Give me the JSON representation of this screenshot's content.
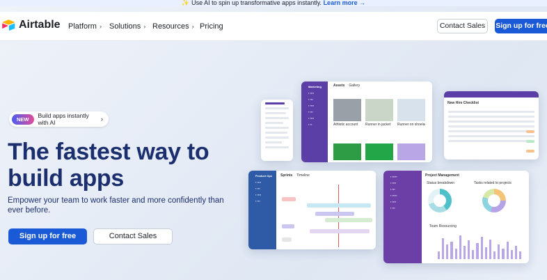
{
  "announcement": {
    "text": "Use AI to spin up transformative apps instantly.",
    "link": "Learn more →"
  },
  "nav": {
    "brand": "Airtable",
    "items": [
      {
        "label": "Platform",
        "has_menu": true
      },
      {
        "label": "Solutions",
        "has_menu": true
      },
      {
        "label": "Resources",
        "has_menu": true
      },
      {
        "label": "Pricing",
        "has_menu": false
      }
    ],
    "contact_sales": "Contact Sales",
    "sign_up": "Sign up for free"
  },
  "hero": {
    "badge": "NEW",
    "badge_text": "Build apps instantly with AI",
    "headline": "The fastest way to build apps",
    "subheadline": "Empower your team to work faster and more confidently than ever before.",
    "primary_cta": "Sign up for free",
    "secondary_cta": "Contact Sales"
  },
  "previews": {
    "marketing": {
      "title": "Marketing",
      "tabs": [
        "Assets",
        "Gallery"
      ],
      "cards": [
        "Athletic account",
        "Runner in jacket",
        "Runner on shoelace"
      ]
    },
    "checklist": {
      "title": "New Hire Checklist"
    },
    "product_ops": {
      "title": "Product Ops",
      "tabs": [
        "Sprints",
        "Timeline"
      ]
    },
    "project": {
      "title": "Project Management",
      "panels": [
        "Status breakdown",
        "Tasks related to projects",
        "Team Resourcing"
      ]
    }
  },
  "colors": {
    "accent": "#1a5ad6",
    "headline": "#1b2f6e",
    "purple": "#5b3fa6"
  }
}
